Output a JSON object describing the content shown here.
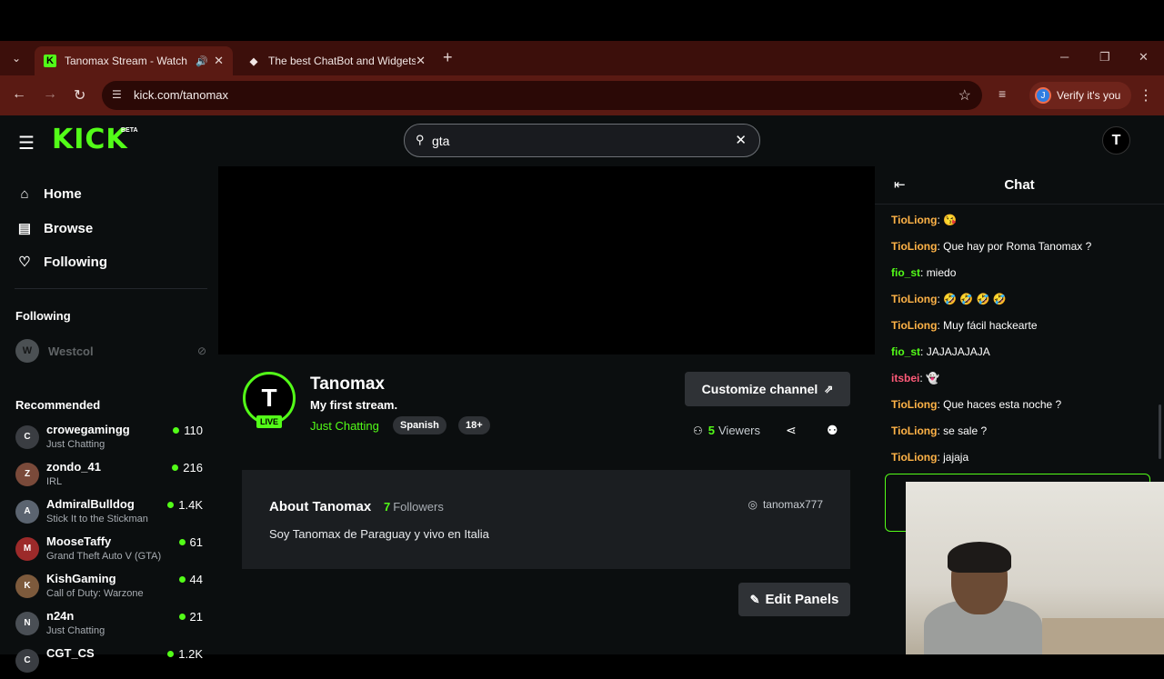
{
  "browser": {
    "tabs": [
      {
        "title": "Tanomax Stream - Watch Li",
        "favicon": "K",
        "active": true
      },
      {
        "title": "The best ChatBot and Widgets",
        "favicon": "◆",
        "active": false
      }
    ],
    "url": "kick.com/tanomax",
    "profile_label": "Verify it's you",
    "profile_initial": "J"
  },
  "header": {
    "logo": "KICK",
    "logo_badge": "BETA",
    "search_value": "gta",
    "user_initial": "T"
  },
  "sidebar": {
    "nav": [
      {
        "label": "Home",
        "icon": "home-icon"
      },
      {
        "label": "Browse",
        "icon": "browse-icon"
      },
      {
        "label": "Following",
        "icon": "heart-icon"
      }
    ],
    "following_heading": "Following",
    "following": [
      {
        "name": "Westcol",
        "initial": "W"
      }
    ],
    "recommended_heading": "Recommended",
    "recommended": [
      {
        "name": "crowegamingg",
        "category": "Just Chatting",
        "viewers": "110",
        "initial": "C",
        "color": "#3a3d42"
      },
      {
        "name": "zondo_41",
        "category": "IRL",
        "viewers": "216",
        "initial": "Z",
        "color": "#7a4a3a"
      },
      {
        "name": "AdmiralBulldog",
        "category": "Stick It to the Stickman",
        "viewers": "1.4K",
        "initial": "A",
        "color": "#5b6470"
      },
      {
        "name": "MooseTaffy",
        "category": "Grand Theft Auto V (GTA)",
        "viewers": "61",
        "initial": "M",
        "color": "#9c2a2a"
      },
      {
        "name": "KishGaming",
        "category": "Call of Duty: Warzone",
        "viewers": "44",
        "initial": "K",
        "color": "#7d5a3c"
      },
      {
        "name": "n24n",
        "category": "Just Chatting",
        "viewers": "21",
        "initial": "N",
        "color": "#4a4f55"
      },
      {
        "name": "CGT_CS",
        "category": "",
        "viewers": "1.2K",
        "initial": "C",
        "color": "#3a3d42"
      }
    ]
  },
  "channel": {
    "name": "Tanomax",
    "avatar_initial": "T",
    "live_label": "LIVE",
    "stream_title": "My first stream.",
    "category": "Just Chatting",
    "tags": [
      "Spanish",
      "18+"
    ],
    "customize_label": "Customize channel",
    "viewers_count": "5",
    "viewers_label": "Viewers",
    "about_heading": "About Tanomax",
    "followers_count": "7",
    "followers_label": "Followers",
    "instagram": "tanomax777",
    "bio": "Soy Tanomax de Paraguay y vivo en Italia",
    "edit_panels_label": "Edit Panels"
  },
  "chat": {
    "title": "Chat",
    "messages": [
      {
        "user": "TioLiong",
        "text": "😘",
        "color": "orange"
      },
      {
        "user": "TioLiong",
        "text": "Que hay por Roma Tanomax ?",
        "color": "orange"
      },
      {
        "user": "fio_st",
        "text": "miedo",
        "color": "green"
      },
      {
        "user": "TioLiong",
        "text": "🤣 🤣 🤣 🤣",
        "color": "orange"
      },
      {
        "user": "TioLiong",
        "text": "Muy fácil hackearte",
        "color": "orange"
      },
      {
        "user": "fio_st",
        "text": "JAJAJAJAJA",
        "color": "green"
      },
      {
        "user": "itsbei",
        "text": "👻",
        "color": "pink"
      },
      {
        "user": "TioLiong",
        "text": "Que haces esta noche ?",
        "color": "orange"
      },
      {
        "user": "TioLiong",
        "text": "se sale ?",
        "color": "orange"
      },
      {
        "user": "TioLiong",
        "text": "jajaja",
        "color": "orange"
      }
    ]
  },
  "colors": {
    "accent": "#53fc18",
    "background": "#0b0e0f",
    "browser_frame": "#5a1a13"
  }
}
